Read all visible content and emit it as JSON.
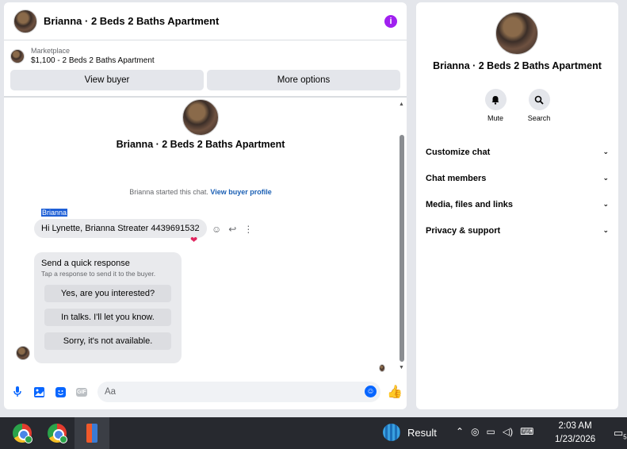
{
  "chat": {
    "header_title": "Brianna · 2 Beds 2 Baths Apartment",
    "listing_label": "Marketplace",
    "listing_value": "$1,100 - 2 Beds 2 Baths Apartment",
    "view_buyer_label": "View buyer",
    "more_options_label": "More options"
  },
  "conversation": {
    "title": "Brianna · 2 Beds 2 Baths Apartment",
    "started_text": "Brianna started this chat.",
    "view_profile_link": "View buyer profile",
    "sender_name": "Brianna",
    "message_text": "Hi Lynette, Brianna Streater 4439691532",
    "reaction": "❤"
  },
  "quick_response": {
    "title": "Send a quick response",
    "subtitle": "Tap a response to send it to the buyer.",
    "options": [
      "Yes, are you interested?",
      "In talks. I'll let you know.",
      "Sorry, it's not available."
    ]
  },
  "composer": {
    "placeholder": "Aa",
    "gif_label": "GIF"
  },
  "info": {
    "title": "Brianna · 2 Beds 2 Baths Apartment",
    "mute_label": "Mute",
    "search_label": "Search",
    "sections": [
      "Customize chat",
      "Chat members",
      "Media, files and links",
      "Privacy & support"
    ]
  },
  "taskbar": {
    "weather_label": "Result",
    "time": "2:03 AM",
    "date": "1/23/2026",
    "notification_count": "5"
  },
  "colors": {
    "accent": "#0866ff",
    "info_purple": "#a020f0",
    "reaction_red": "#e0245e"
  }
}
